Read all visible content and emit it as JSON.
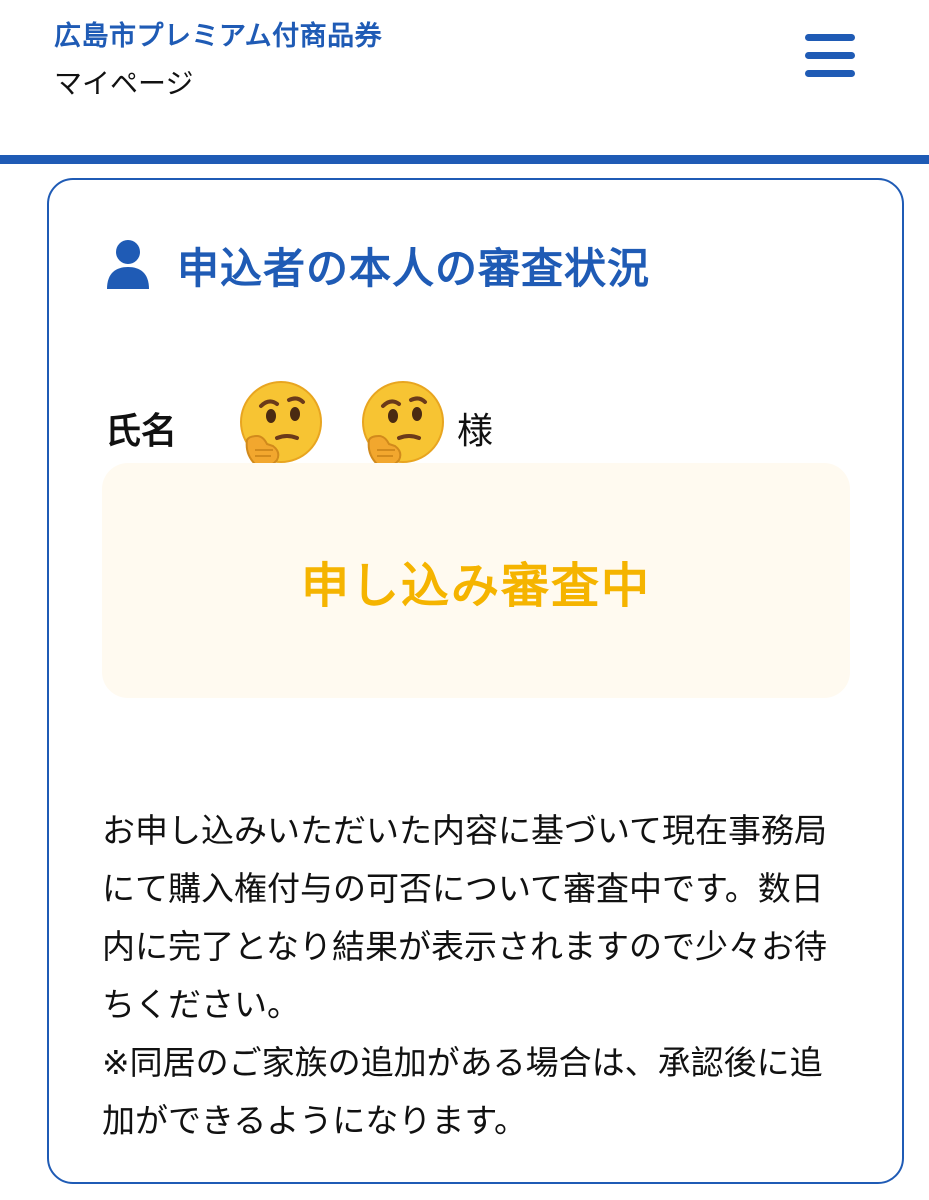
{
  "header": {
    "brand": "広島市プレミアム付商品券",
    "subtitle": "マイページ",
    "menu_icon": "hamburger-menu-icon",
    "accent_color": "#1f5bb5"
  },
  "card": {
    "icon": "person-icon",
    "title": "申込者の本人の審査状況",
    "name_label": "氏名",
    "name_emojis": [
      "thinking-face-emoji",
      "thinking-face-emoji"
    ],
    "honorific": "様",
    "status": {
      "text": "申し込み審査中",
      "color": "#f5b400",
      "background": "#fffaf0"
    },
    "description": "お申し込みいただいた内容に基づいて現在事務局にて購入権付与の可否について審査中です。数日内に完了となり結果が表示されますので少々お待ちください。",
    "note": "※同居のご家族の追加がある場合は、承認後に追加ができるようになります。"
  }
}
